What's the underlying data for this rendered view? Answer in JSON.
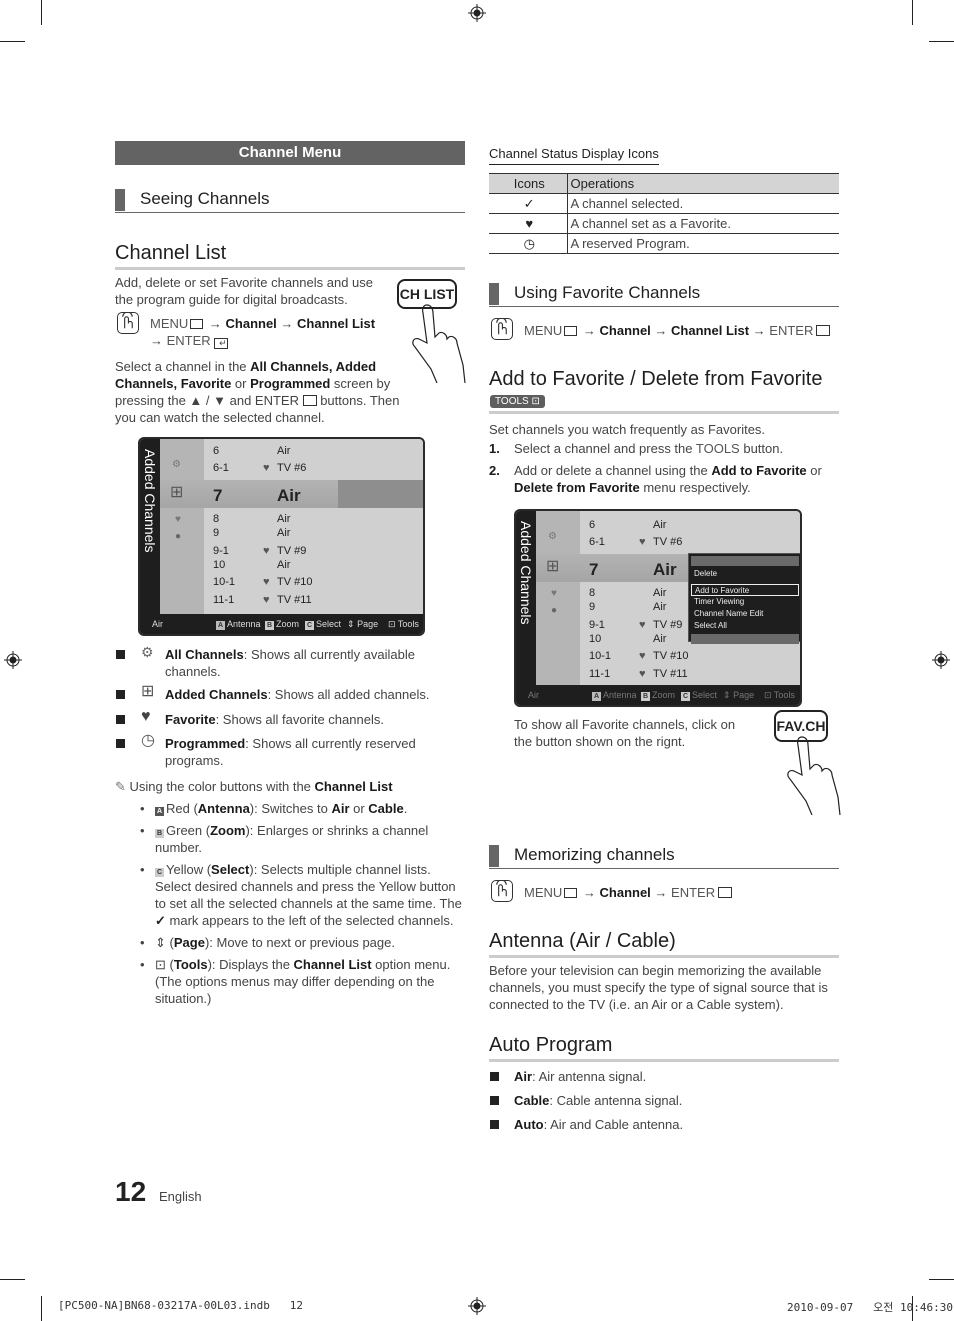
{
  "left": {
    "banner": "Channel Menu",
    "seeing_channels": "Seeing Channels",
    "channel_list": {
      "title": "Channel List",
      "intro": "Add, delete or set Favorite channels and use the program guide for digital broadcasts.",
      "remote_button": "CH LIST",
      "menu_path": {
        "menu": "MENU",
        "arrow1": " → ",
        "channel": "Channel",
        "arrow2": " → ",
        "target": "Channel List",
        "arrow3": "→ ",
        "enter": "ENTER"
      },
      "select_text": {
        "p1": "Select a channel in the ",
        "b1": "All Channels, Added Channels, Favorite",
        "p2": " or ",
        "b2": "Programmed",
        "p3": " screen by pressing the ▲ / ▼ and ENTER ",
        "p4": " buttons. Then you can watch the selected channel."
      }
    },
    "tv_screen": {
      "side_label": "Added Channels",
      "rows": [
        {
          "ch": "6",
          "name": "Air",
          "fav": false
        },
        {
          "ch": "6-1",
          "name": "TV #6",
          "fav": true
        },
        {
          "ch": "7",
          "name": "Air",
          "fav": false,
          "selected": true
        },
        {
          "ch": "8",
          "name": "Air",
          "fav": false
        },
        {
          "ch": "9",
          "name": "Air",
          "fav": false
        },
        {
          "ch": "9-1",
          "name": "TV #9",
          "fav": true
        },
        {
          "ch": "10",
          "name": "Air",
          "fav": false
        },
        {
          "ch": "10-1",
          "name": "TV #10",
          "fav": true
        },
        {
          "ch": "11-1",
          "name": "TV #11",
          "fav": true
        }
      ],
      "footer": {
        "source": "Air",
        "a": "Antenna",
        "b": "Zoom",
        "c": "Select",
        "page": "Page",
        "tools": "Tools"
      }
    },
    "bullets": [
      {
        "term": "All Channels",
        "desc": ": Shows all currently available channels."
      },
      {
        "term": "Added Channels",
        "desc": ": Shows all added channels."
      },
      {
        "term": "Favorite",
        "desc": ": Shows all favorite channels."
      },
      {
        "term": "Programmed",
        "desc": ": Shows all currently reserved programs."
      }
    ],
    "note": {
      "text": "Using the color buttons with the ",
      "bold": "Channel List"
    },
    "sub_bullets": {
      "red": {
        "pre": "Red (",
        "term": "Antenna",
        "mid": "): Switches to ",
        "b1": "Air",
        "or": " or ",
        "b2": "Cable",
        "end": "."
      },
      "green": {
        "pre": "Green (",
        "term": "Zoom",
        "desc": "): Enlarges or shrinks a channel number."
      },
      "yellow": {
        "pre": "Yellow (",
        "term": "Select",
        "desc": "): Selects multiple channel lists. Select desired channels and press the Yellow button to set all the selected channels at the same time. The ",
        "desc2": " mark appears to the left of the selected channels."
      },
      "page": {
        "pre": " (",
        "term": "Page",
        "desc": "): Move to next or previous page."
      },
      "tools": {
        "pre": " (",
        "term": "Tools",
        "desc": "): Displays the ",
        "b": "Channel List",
        "desc2": " option menu. (The options menus may differ depending on the situation.)"
      }
    }
  },
  "right": {
    "status_icons": {
      "title": "Channel Status Display Icons",
      "headers": [
        "Icons",
        "Operations"
      ],
      "rows": [
        {
          "icon": "✓",
          "icon_name": "checkmark-icon",
          "op": "A channel selected."
        },
        {
          "icon": "♥",
          "icon_name": "heart-icon",
          "op": "A channel set as a Favorite."
        },
        {
          "icon": "◷",
          "icon_name": "clock-icon",
          "op": "A reserved Program."
        }
      ]
    },
    "using_favorite": "Using Favorite Channels",
    "fav_menu_path": {
      "menu": "MENU",
      "a1": " → ",
      "channel": "Channel",
      "a2": " → ",
      "target": "Channel List",
      "a3": " → ",
      "enter": "ENTER"
    },
    "add_fav": {
      "title": "Add to Favorite / Delete from Favorite",
      "tools_badge": "TOOLS",
      "intro": "Set channels you watch frequently as Favorites.",
      "step1": {
        "num": "1.",
        "pre": "Select a channel and press the ",
        "term": "TOOLS",
        "post": " button."
      },
      "step2": {
        "num": "2.",
        "pre": "Add or delete a channel using the ",
        "b1": "Add to Favorite",
        "or": " or ",
        "b2": "Delete from Favorite",
        "post": " menu respectively."
      }
    },
    "tv_screen2": {
      "side_label": "Added Channels",
      "popup": [
        "Delete",
        "Add to Favorite",
        "Timer Viewing",
        "Channel Name Edit",
        "Select All"
      ],
      "popup_focus": "Add to Favorite"
    },
    "fav_note": "To show all Favorite channels, click on the button shown on the rignt.",
    "fav_button": "FAV.CH",
    "memorizing": "Memorizing channels",
    "mem_menu_path": {
      "menu": "MENU",
      "a1": " → ",
      "channel": "Channel",
      "a2": " → ",
      "enter": "ENTER"
    },
    "antenna": {
      "title": "Antenna (Air / Cable)",
      "text": "Before your television can begin memorizing the available channels, you must specify the type of signal source that is connected to the TV (i.e. an Air or a Cable system)."
    },
    "auto_program": {
      "title": "Auto Program",
      "items": [
        {
          "term": "Air",
          "desc": ": Air antenna signal."
        },
        {
          "term": "Cable",
          "desc": ": Cable antenna signal."
        },
        {
          "term": "Auto",
          "desc": ": Air and Cable antenna."
        }
      ]
    }
  },
  "footer": {
    "page_number": "12",
    "language": "English",
    "file": "[PC500-NA]BN68-03217A-00L03.indb   12",
    "timestamp": "2010-09-07   오전 10:46:30"
  }
}
